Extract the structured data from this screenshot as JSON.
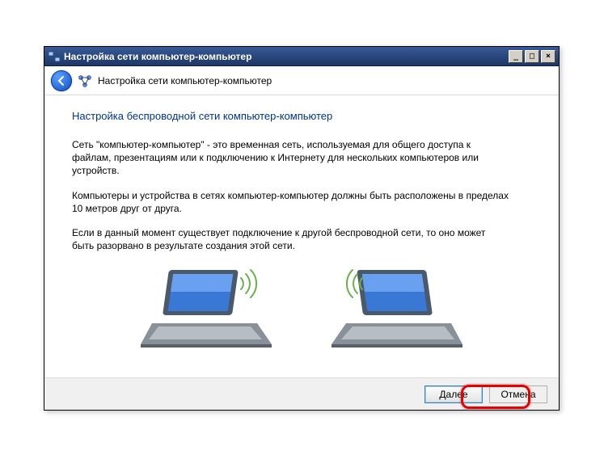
{
  "window": {
    "title": "Настройка сети компьютер-компьютер"
  },
  "header": {
    "title": "Настройка сети компьютер-компьютер"
  },
  "page": {
    "heading": "Настройка беспроводной сети компьютер-компьютер",
    "p1": "Сеть \"компьютер-компьютер\" - это временная сеть, используемая для общего доступа к файлам, презентациям или к подключению к Интернету для нескольких компьютеров или устройств.",
    "p2": "Компьютеры и устройства в сетях компьютер-компьютер должны быть расположены в пределах 10 метров друг от друга.",
    "p3": "Если в данный момент существует подключение к другой беспроводной сети, то оно может быть разорвано в результате создания этой сети."
  },
  "buttons": {
    "next": "Далее",
    "cancel": "Отмена"
  }
}
